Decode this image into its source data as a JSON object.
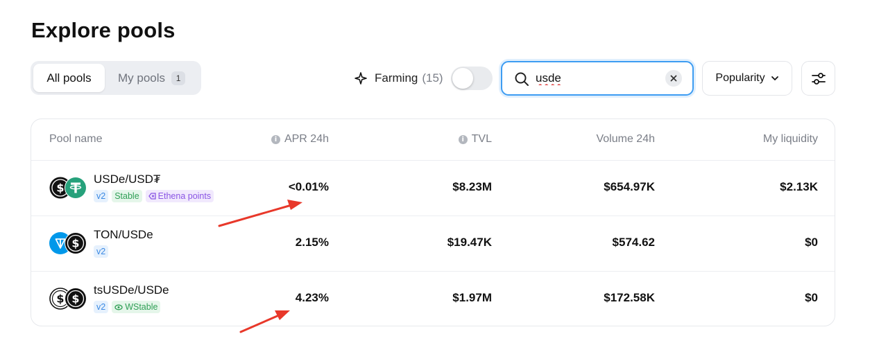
{
  "page": {
    "title": "Explore pools"
  },
  "tabs": [
    {
      "label": "All pools",
      "active": true
    },
    {
      "label": "My pools",
      "badge": "1",
      "active": false
    }
  ],
  "farming": {
    "label": "Farming",
    "count": "(15)",
    "enabled": false
  },
  "search": {
    "value": "usde",
    "placeholder": ""
  },
  "sort": {
    "label": "Popularity"
  },
  "table": {
    "columns": [
      "Pool name",
      "APR 24h",
      "TVL",
      "Volume 24h",
      "My liquidity"
    ],
    "rows": [
      {
        "pair": "USDe/USD₮",
        "tags": [
          "v2",
          "Stable",
          "Ethena points"
        ],
        "apr": "<0.01%",
        "tvl": "$8.23M",
        "volume": "$654.97K",
        "liquidity": "$2.13K"
      },
      {
        "pair": "TON/USDe",
        "tags": [
          "v2"
        ],
        "apr": "2.15%",
        "tvl": "$19.47K",
        "volume": "$574.62",
        "liquidity": "$0"
      },
      {
        "pair": "tsUSDe/USDe",
        "tags": [
          "v2",
          "WStable"
        ],
        "apr": "4.23%",
        "tvl": "$1.97M",
        "volume": "$172.58K",
        "liquidity": "$0"
      }
    ]
  },
  "icons": {
    "usde": "usde-coin-icon",
    "usdt": "tether-coin-icon",
    "ton": "ton-coin-icon",
    "tsusde": "tsusde-coin-icon"
  },
  "colors": {
    "accent": "#3d9cf2",
    "arrow": "#e8382a",
    "tag_v2": "#3b89e3",
    "tag_stable": "#2f9f55",
    "tag_ethena": "#8a55e4"
  }
}
